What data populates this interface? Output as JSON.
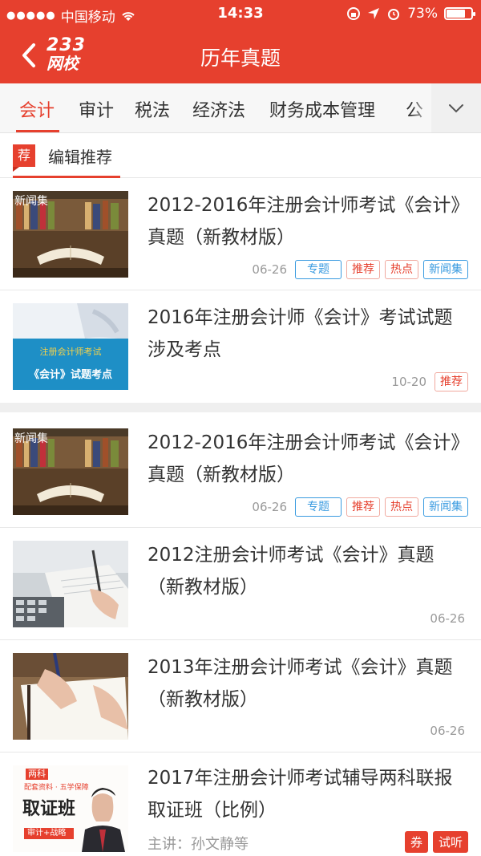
{
  "status_bar": {
    "carrier": "中国移动",
    "time": "14:33",
    "battery": "73%",
    "battery_level": 0.73
  },
  "nav": {
    "logo_top": "233",
    "logo_bottom": "网校",
    "title": "历年真题"
  },
  "tabs": [
    "会计",
    "审计",
    "税法",
    "经济法",
    "财务成本管理",
    "公"
  ],
  "section": {
    "badge": "荐",
    "title": "编辑推荐"
  },
  "articles": [
    {
      "title": "2012-2016年注册会计师考试《会计》真题（新教材版）",
      "date": "06-26",
      "thumb_label": "新闻集",
      "tags": [
        "专题",
        "推荐",
        "热点",
        "新闻集"
      ]
    },
    {
      "title": "2016年注册会计师《会计》考试试题涉及考点",
      "date": "10-20",
      "thumb_line1": "注册会计师考试",
      "thumb_line2": "《会计》试题考点",
      "tags": [
        "推荐"
      ]
    },
    {
      "title": "2012-2016年注册会计师考试《会计》真题（新教材版）",
      "date": "06-26",
      "thumb_label": "新闻集",
      "tags": [
        "专题",
        "推荐",
        "热点",
        "新闻集"
      ]
    },
    {
      "title": "2012注册会计师考试《会计》真题（新教材版）",
      "date": "06-26"
    },
    {
      "title": "2013年注册会计师考试《会计》真题（新教材版）",
      "date": "06-26"
    },
    {
      "title": "2017年注册会计师考试辅导两科联报取证班（比例）",
      "speaker": "主讲：孙文静等",
      "thumb_badge": "两科",
      "thumb_sub": "配套资料 · 五学保障",
      "thumb_main": "取证班",
      "thumb_bottom": "审计+战略",
      "buttons": [
        "券",
        "试听"
      ]
    }
  ]
}
